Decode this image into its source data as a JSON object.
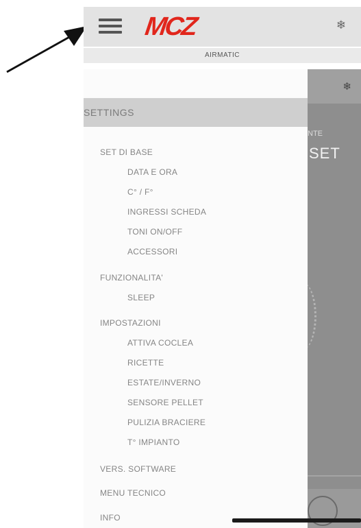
{
  "header": {
    "logo_text": "MCZ",
    "snow_icon": "❄"
  },
  "subheader": {
    "title": "AIRMATIC"
  },
  "background_screen": {
    "snow_icon": "❄",
    "partial_label": "NTE",
    "set_label": "SET"
  },
  "menu": {
    "title": "SETTINGS",
    "items": [
      {
        "label": "SET DI BASE",
        "level": 1
      },
      {
        "label": "DATA E ORA",
        "level": 2
      },
      {
        "label": "C° / F°",
        "level": 2
      },
      {
        "label": "INGRESSI SCHEDA",
        "level": 2
      },
      {
        "label": "TONI ON/OFF",
        "level": 2
      },
      {
        "label": "ACCESSORI",
        "level": 2
      },
      {
        "label": "FUNZIONALITA'",
        "level": 1
      },
      {
        "label": "SLEEP",
        "level": 2
      },
      {
        "label": "IMPOSTAZIONI",
        "level": 1
      },
      {
        "label": "ATTIVA COCLEA",
        "level": 2
      },
      {
        "label": "RICETTE",
        "level": 2
      },
      {
        "label": "ESTATE/INVERNO",
        "level": 2
      },
      {
        "label": "SENSORE PELLET",
        "level": 2
      },
      {
        "label": "PULIZIA BRACIERE",
        "level": 2
      },
      {
        "label": "T° IMPIANTO",
        "level": 2
      },
      {
        "label": "VERS. SOFTWARE",
        "level": 1
      },
      {
        "label": "MENU TECNICO",
        "level": 1
      },
      {
        "label": "INFO",
        "level": 1
      }
    ]
  }
}
